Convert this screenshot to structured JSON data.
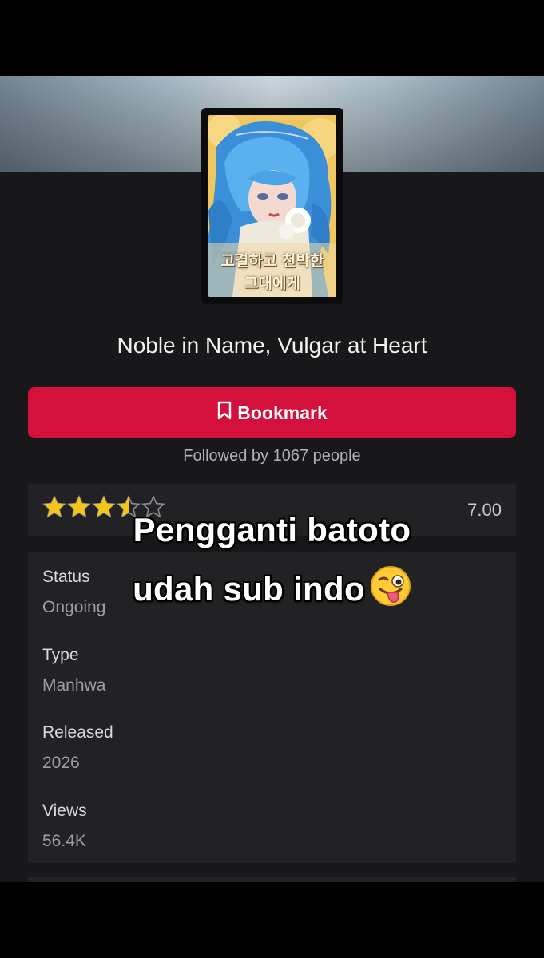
{
  "manga": {
    "title": "Noble in Name, Vulgar at Heart",
    "cover_text_line1": "고결하고 천박한",
    "cover_text_line2": "그대에게"
  },
  "bookmark": {
    "label": "Bookmark",
    "icon": "bookmark-icon"
  },
  "followers": {
    "text": "Followed by 1067 people"
  },
  "rating": {
    "value": "7.00",
    "stars_filled": 3.5,
    "stars_total": 5,
    "star_color": "#f5c518"
  },
  "info": {
    "status_label": "Status",
    "status_value": "Ongoing",
    "type_label": "Type",
    "type_value": "Manhwa",
    "released_label": "Released",
    "released_value": "2026",
    "views_label": "Views",
    "views_value": "56.4K"
  },
  "overlay": {
    "line1": "Pengganti batoto",
    "line2": "udah sub indo",
    "emoji": "winking-face-with-tongue"
  },
  "colors": {
    "accent": "#d3113c",
    "background": "#18181b",
    "panel": "#222225"
  }
}
